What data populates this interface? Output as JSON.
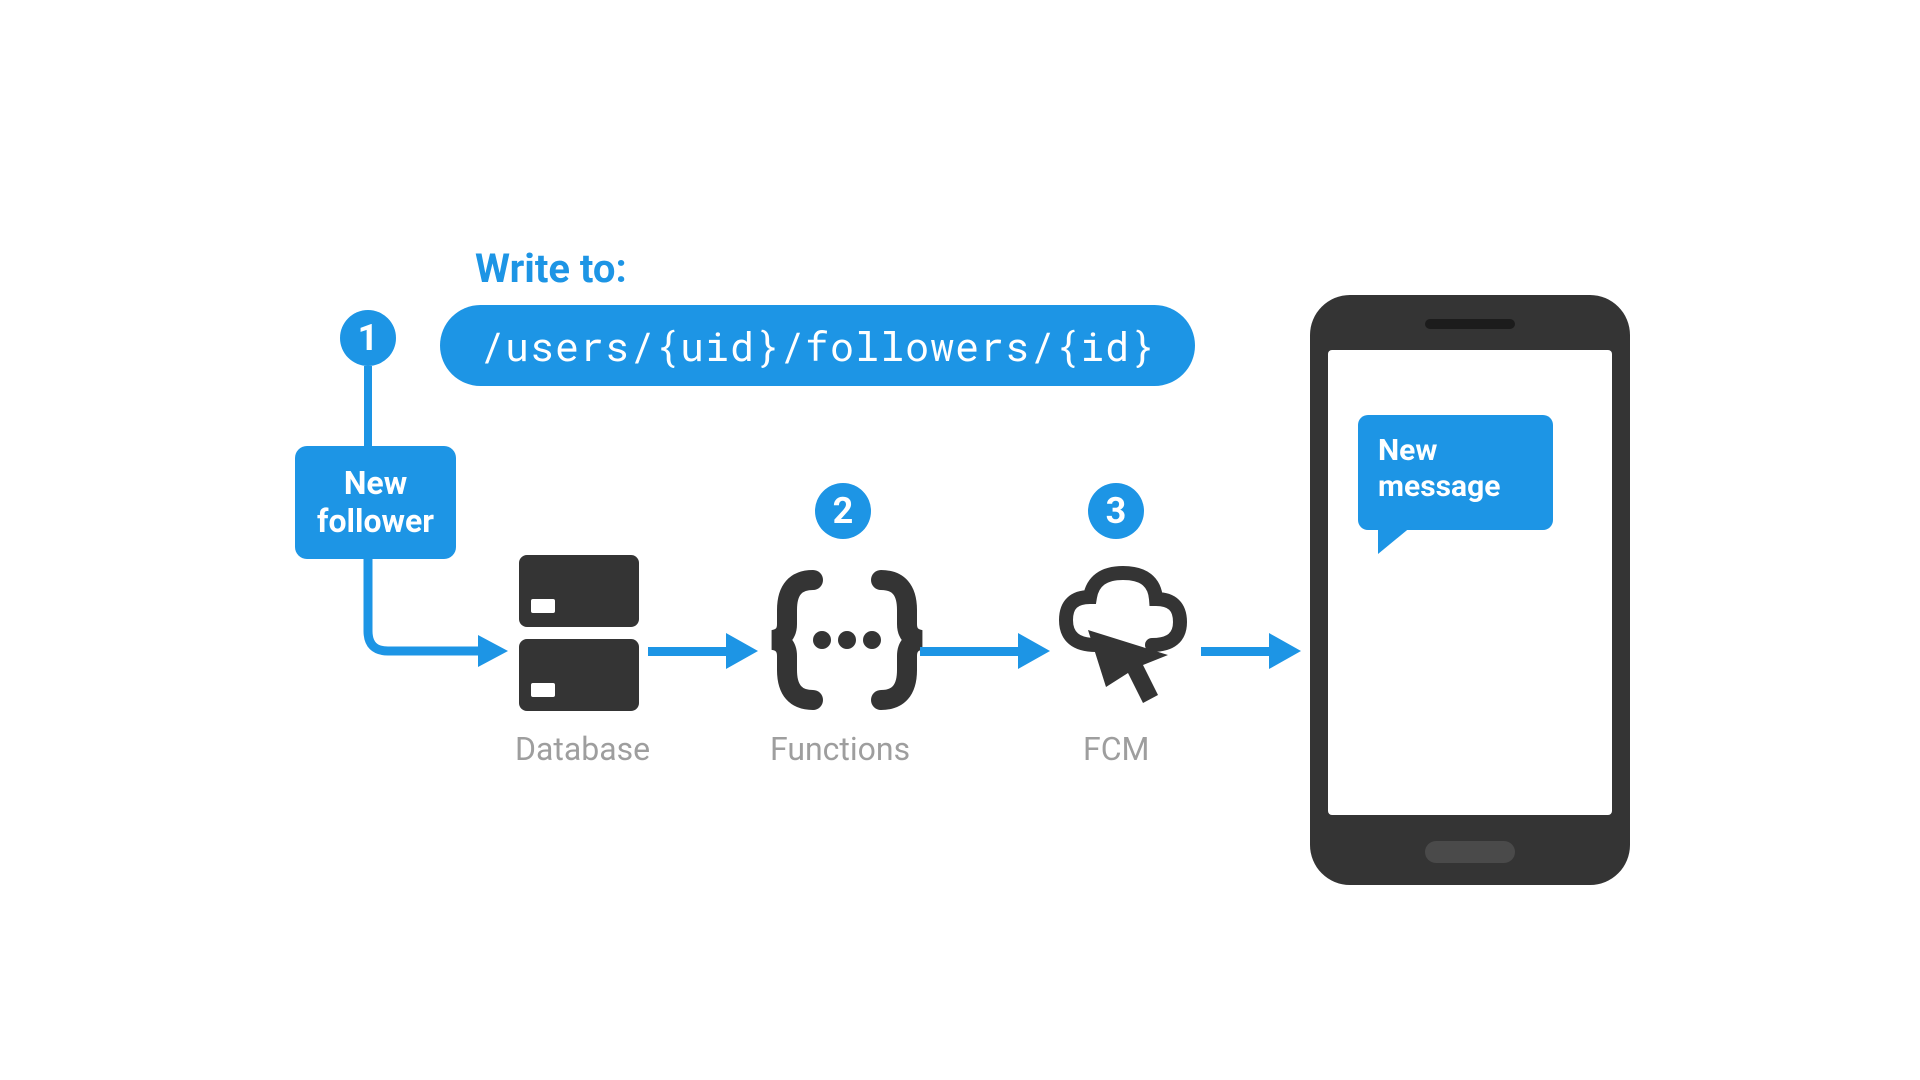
{
  "header": {
    "write_label": "Write to:",
    "path": "/users/{uid}/followers/{id}"
  },
  "steps": {
    "one": "1",
    "two": "2",
    "three": "3"
  },
  "trigger_box": "New\nfollower",
  "nodes": {
    "database": "Database",
    "functions": "Functions",
    "fcm": "FCM"
  },
  "phone": {
    "message": "New\nmessage"
  },
  "colors": {
    "primary": "#1d95e5",
    "icon_dark": "#343434",
    "label_grey": "#9e9e9e"
  }
}
